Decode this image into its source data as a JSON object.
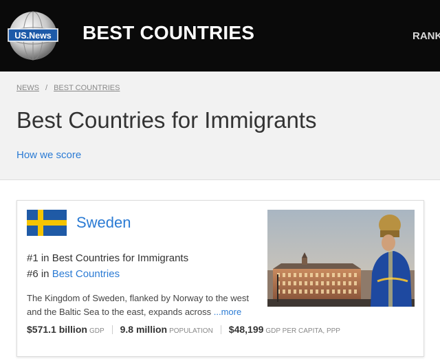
{
  "header": {
    "logo_text": "US.News",
    "brand": "BEST COUNTRIES",
    "nav_rank": "RANK"
  },
  "breadcrumb": {
    "items": [
      "NEWS",
      "BEST COUNTRIES"
    ],
    "separator": "/"
  },
  "page": {
    "title": "Best Countries for Immigrants",
    "how_we_score": "How we score"
  },
  "card": {
    "country": "Sweden",
    "rank1_prefix": "#1 in ",
    "rank1_text": "Best Countries for Immigrants",
    "rank2_prefix": "#6 in ",
    "rank2_link": "Best Countries",
    "description": "The Kingdom of Sweden, flanked by Norway to the west and the Baltic Sea to the east, expands across ",
    "more": "...more",
    "stats": {
      "gdp_value": "$571.1 billion",
      "gdp_label": "GDP",
      "population_value": "9.8 million",
      "population_label": "POPULATION",
      "gdp_pc_value": "$48,199",
      "gdp_pc_label": "GDP PER CAPITA, PPP"
    }
  },
  "colors": {
    "header_bg": "#0a0a0a",
    "link": "#2b7bd4",
    "sweden_blue": "#1f5aa6",
    "sweden_yellow": "#f5c400"
  }
}
